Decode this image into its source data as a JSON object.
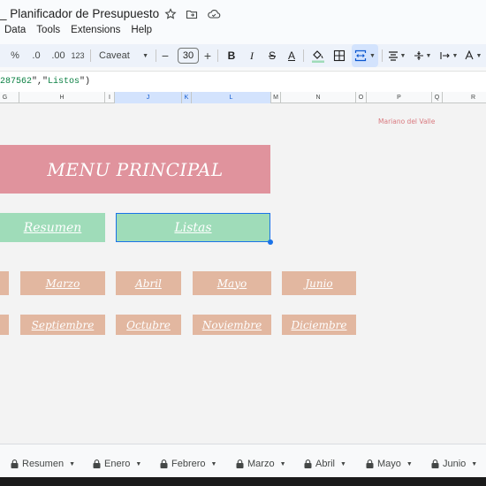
{
  "doc": {
    "title": "_ Planificador de Presupuesto",
    "icons": [
      "star-icon",
      "move-to-folder-icon",
      "cloud-saved-icon"
    ]
  },
  "menu": [
    "Data",
    "Tools",
    "Extensions",
    "Help"
  ],
  "toolbar": {
    "percent": "%",
    "decrease_decimals": ".0",
    "increase_decimals": ".00",
    "number_format": "123",
    "font": "Caveat",
    "font_size": "30",
    "minus": "−",
    "plus": "+",
    "bold": "B",
    "italic": "I",
    "strikethrough": "S",
    "text_color": "A"
  },
  "formula": {
    "num": "287562",
    "sep": "\",\"",
    "str": "Listos",
    "close": "\")"
  },
  "columns": [
    "G",
    "H",
    "I",
    "J",
    "K",
    "L",
    "M",
    "N",
    "O",
    "P",
    "Q",
    "R"
  ],
  "grid": {
    "author": "Mariano del Valle",
    "menu_title": "MENU PRINCIPAL",
    "resumen": "Resumen",
    "listas": "Listas",
    "months_row1": [
      "Marzo",
      "Abril",
      "Mayo",
      "Junio"
    ],
    "months_row2": [
      "Septiembre",
      "Octubre",
      "Noviembre",
      "Diciembre"
    ]
  },
  "tabs": [
    "Resumen",
    "Enero",
    "Febrero",
    "Marzo",
    "Abril",
    "Mayo",
    "Junio"
  ],
  "colors": {
    "banner": "#e0939d",
    "green": "#9fdcb9",
    "month": "#e2b7a0",
    "selection": "#1a73e8"
  }
}
